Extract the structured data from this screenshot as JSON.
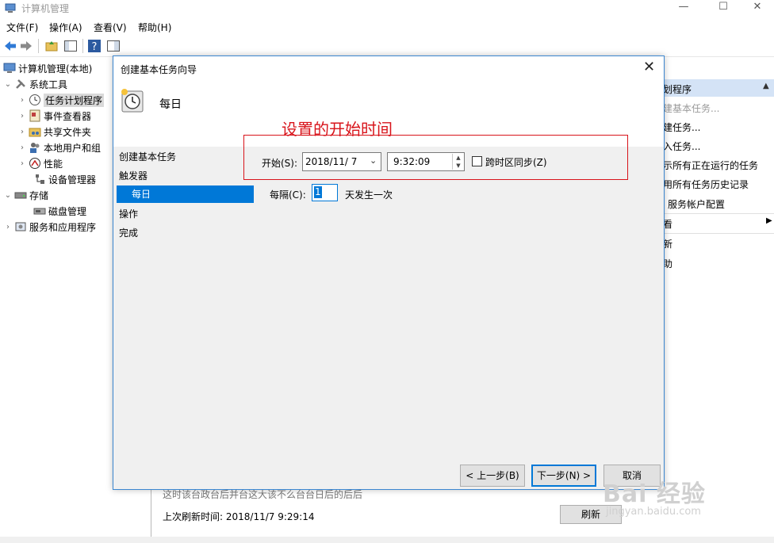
{
  "window": {
    "title": "计算机管理",
    "controls": [
      "—",
      "☐",
      "✕"
    ]
  },
  "menu": [
    "文件(F)",
    "操作(A)",
    "查看(V)",
    "帮助(H)"
  ],
  "tree": {
    "root": "计算机管理(本地)",
    "system_tools": "系统工具",
    "task_scheduler": "任务计划程序",
    "event_viewer": "事件查看器",
    "shared_folders": "共享文件夹",
    "local_users": "本地用户和组",
    "performance": "性能",
    "device_manager": "设备管理器",
    "storage": "存储",
    "disk_management": "磁盘管理",
    "services_apps": "服务和应用程序"
  },
  "actions": {
    "header": "划程序",
    "items": [
      "建基本任务...",
      "建任务...",
      "入任务...",
      "示所有正在运行的任务",
      "用所有任务历史记录",
      "服务帐户配置",
      "看",
      "新",
      "助"
    ]
  },
  "bottom": {
    "cut_text": "这时该台政台后并台这大该不么台台日后的后后",
    "last_refresh": "上次刷新时间: 2018/11/7 9:29:14",
    "refresh_btn": "刷新"
  },
  "dialog": {
    "title": "创建基本任务向导",
    "close": "✕",
    "header_title": "每日",
    "annotation": "设置的开始时间",
    "steps": [
      "创建基本任务",
      "触发器",
      "每日",
      "操作",
      "完成"
    ],
    "start_label": "开始(S):",
    "start_date": "2018/11/ 7",
    "start_time": "9:32:09",
    "sync_label": "跨时区同步(Z)",
    "interval_label": "每隔(C):",
    "interval_value": "1",
    "interval_suffix": "天发生一次",
    "btn_back": "< 上一步(B)",
    "btn_next": "下一步(N) >",
    "btn_cancel": "取消"
  },
  "watermark": {
    "text": "Bai 经验",
    "sub": "jingyan.baidu.com"
  }
}
